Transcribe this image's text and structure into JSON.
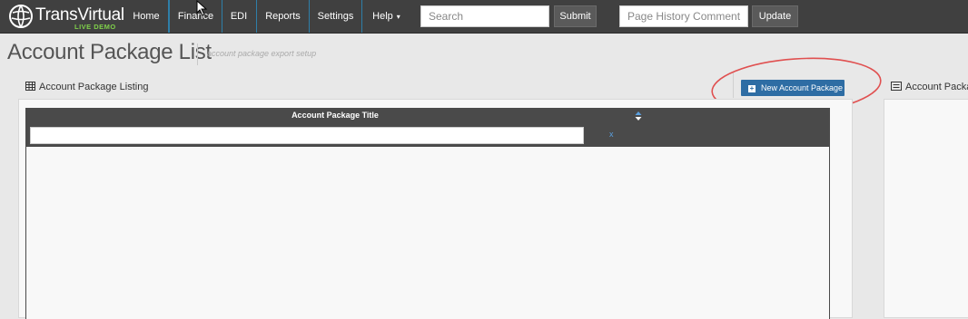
{
  "navbar": {
    "logo": {
      "brand_prefix": "Trans",
      "brand_suffix": "Virtual",
      "tagline": "LIVE DEMO",
      "tagline_color": "#7fd04a"
    },
    "items": [
      {
        "label": "Home"
      },
      {
        "label": "Finance"
      },
      {
        "label": "EDI"
      },
      {
        "label": "Reports"
      },
      {
        "label": "Settings"
      },
      {
        "label": "Help",
        "caret": "▾"
      }
    ],
    "search": {
      "placeholder": "Search",
      "value": ""
    },
    "submit_label": "Submit",
    "history_comment": {
      "placeholder": "Page History Comment",
      "value": ""
    },
    "update_label": "Update"
  },
  "page": {
    "title": "Account Package List",
    "subtitle": "account package export setup"
  },
  "listing_panel": {
    "heading": "Account Package Listing",
    "heading_icon": "table-icon",
    "table": {
      "columns": [
        {
          "label": "Account Package Title",
          "sortable": true
        }
      ],
      "filter": {
        "value": "",
        "clear_label": "x"
      },
      "rows": []
    }
  },
  "new_account_package_button": {
    "label": "New Account Package",
    "icon": "plus-square-icon"
  },
  "detail_panel": {
    "heading": "Account Packa",
    "heading_icon": "list-alt-icon"
  },
  "colors": {
    "navbar_bg": "#404040",
    "nav_divider": "#2e7fa8",
    "primary_button": "#2e6da4",
    "table_header": "#4a4a4a",
    "highlight_ellipse": "#e05050"
  }
}
